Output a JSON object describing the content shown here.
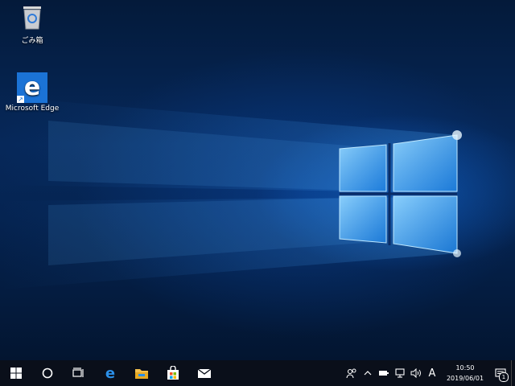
{
  "desktop": {
    "icons": [
      {
        "label": "ごみ箱",
        "icon": "recycle-bin-icon"
      },
      {
        "label": "Microsoft Edge",
        "icon": "edge-icon"
      }
    ]
  },
  "taskbar": {
    "buttons": [
      {
        "icon": "windows-start-icon"
      },
      {
        "icon": "cortana-search-icon"
      },
      {
        "icon": "task-view-icon"
      },
      {
        "icon": "edge-icon"
      },
      {
        "icon": "file-explorer-icon"
      },
      {
        "icon": "store-icon"
      },
      {
        "icon": "mail-icon"
      }
    ],
    "tray": {
      "ime_mode": "A",
      "time": "10:50",
      "date": "2019/06/01",
      "notification_count": "1"
    }
  },
  "colors": {
    "taskbar": "#0a0f1a",
    "accent": "#1b73d6",
    "glow": "#4fb0ff"
  }
}
